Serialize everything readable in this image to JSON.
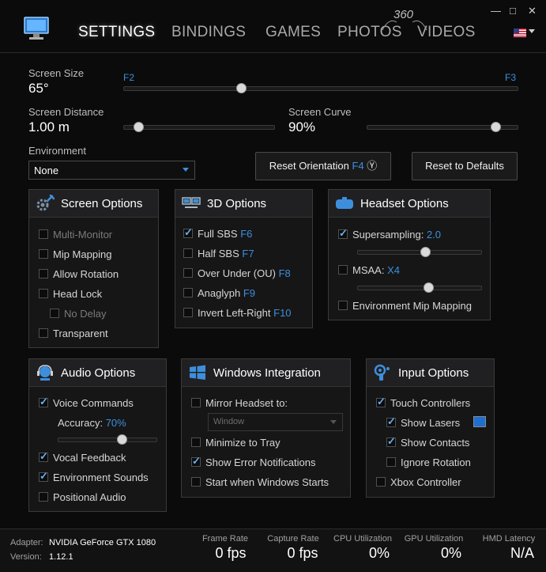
{
  "window": {
    "minimize": "—",
    "maximize": "□",
    "close": "✕"
  },
  "nav": {
    "tabs": [
      "SETTINGS",
      "BINDINGS",
      "GAMES",
      "PHOTOS",
      "VIDEOS"
    ],
    "badge": "360"
  },
  "screen": {
    "size_label": "Screen Size",
    "size_value": "65°",
    "size_min_key": "F2",
    "size_max_key": "F3",
    "size_level": 0.3,
    "distance_label": "Screen Distance",
    "distance_value": "1.00 m",
    "distance_level": 0.1,
    "curve_label": "Screen Curve",
    "curve_value": "90%",
    "curve_level": 0.86
  },
  "environment": {
    "label": "Environment",
    "value": "None"
  },
  "buttons": {
    "reset_orientation": "Reset Orientation",
    "reset_orientation_key": "F4",
    "reset_orientation_icon": "Ⓨ",
    "reset_defaults": "Reset to Defaults"
  },
  "screen_options": {
    "title": "Screen Options",
    "items": [
      {
        "label": "Multi-Monitor",
        "checked": false,
        "disabled": true
      },
      {
        "label": "Mip Mapping",
        "checked": false
      },
      {
        "label": "Allow Rotation",
        "checked": false
      },
      {
        "label": "Head Lock",
        "checked": false
      },
      {
        "label": "No Delay",
        "checked": false,
        "disabled": true
      },
      {
        "label": "Transparent",
        "checked": false
      }
    ]
  },
  "options_3d": {
    "title": "3D Options",
    "items": [
      {
        "label": "Full SBS",
        "key": "F6",
        "checked": true
      },
      {
        "label": "Half SBS",
        "key": "F7",
        "checked": false
      },
      {
        "label": "Over Under (OU)",
        "key": "F8",
        "checked": false
      },
      {
        "label": "Anaglyph",
        "key": "F9",
        "checked": false
      },
      {
        "label": "Invert Left-Right",
        "key": "F10",
        "checked": false
      }
    ]
  },
  "headset_options": {
    "title": "Headset Options",
    "supersampling_label": "Supersampling:",
    "supersampling_value": "2.0",
    "supersampling_checked": true,
    "supersampling_level": 0.55,
    "msaa_label": "MSAA:",
    "msaa_value": "X4",
    "msaa_checked": false,
    "msaa_level": 0.58,
    "env_mip_label": "Environment Mip Mapping",
    "env_mip_checked": false
  },
  "audio_options": {
    "title": "Audio Options",
    "voice_label": "Voice Commands",
    "voice_checked": true,
    "accuracy_label": "Accuracy:",
    "accuracy_value": "70%",
    "accuracy_level": 0.65,
    "items": [
      {
        "label": "Vocal Feedback",
        "checked": true
      },
      {
        "label": "Environment Sounds",
        "checked": true
      },
      {
        "label": "Positional Audio",
        "checked": false
      }
    ]
  },
  "windows_integration": {
    "title": "Windows Integration",
    "mirror_label": "Mirror Headset to:",
    "mirror_checked": false,
    "mirror_select": "Window",
    "items": [
      {
        "label": "Minimize to Tray",
        "checked": false
      },
      {
        "label": "Show Error Notifications",
        "checked": true
      },
      {
        "label": "Start when Windows Starts",
        "checked": false
      }
    ]
  },
  "input_options": {
    "title": "Input Options",
    "items": [
      {
        "label": "Touch Controllers",
        "checked": true,
        "indent": false
      },
      {
        "label": "Show Lasers",
        "checked": true,
        "indent": true
      },
      {
        "label": "Show Contacts",
        "checked": true,
        "indent": true
      },
      {
        "label": "Ignore Rotation",
        "checked": false,
        "indent": true
      },
      {
        "label": "Xbox Controller",
        "checked": false,
        "indent": false
      }
    ],
    "laser_color": "#1e6fd0"
  },
  "footer": {
    "adapter_label": "Adapter:",
    "adapter_value": "NVIDIA GeForce GTX 1080",
    "version_label": "Version:",
    "version_value": "1.12.1",
    "stats": [
      {
        "label": "Frame Rate",
        "value": "0 fps"
      },
      {
        "label": "Capture Rate",
        "value": "0 fps"
      },
      {
        "label": "CPU Utilization",
        "value": "0%"
      },
      {
        "label": "GPU Utilization",
        "value": "0%"
      },
      {
        "label": "HMD Latency",
        "value": "N/A"
      }
    ]
  },
  "colors": {
    "accent": "#3d8fdc",
    "check": "#66aef2",
    "background": "#0b0b0c",
    "panel": "#161617"
  }
}
